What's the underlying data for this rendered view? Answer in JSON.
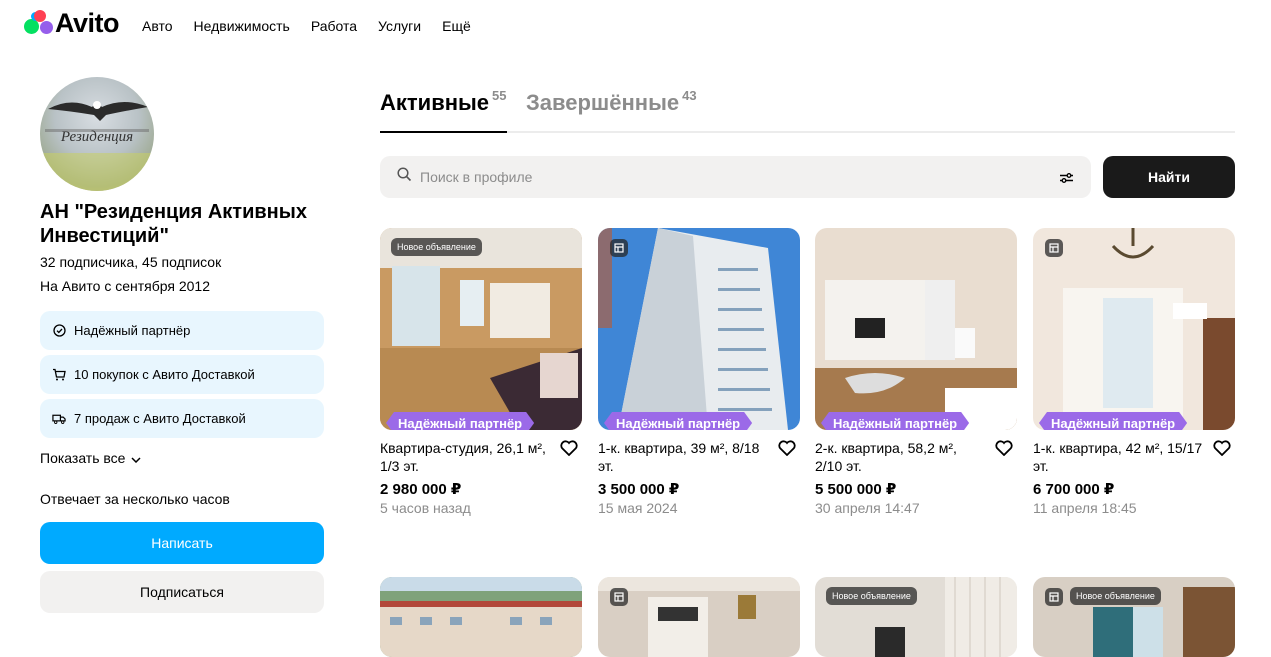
{
  "header": {
    "logo_text": "Avito",
    "nav": [
      "Авто",
      "Недвижимость",
      "Работа",
      "Услуги",
      "Ещё"
    ]
  },
  "profile": {
    "name": "АН \"Резиденция Активных Инвестиций\"",
    "subscribers": "32 подписчика, 45 подписок",
    "since": "На Авито с сентября 2012",
    "avatar_text": "Резиденция",
    "badges": [
      {
        "icon": "check-circle-icon",
        "label": "Надёжный партнёр"
      },
      {
        "icon": "cart-icon",
        "label": "10 покупок с Авито Доставкой"
      },
      {
        "icon": "truck-icon",
        "label": "7 продаж с Авито Доставкой"
      }
    ],
    "show_all": "Показать все",
    "response_time": "Отвечает за несколько часов",
    "write_button": "Написать",
    "subscribe_button": "Подписаться"
  },
  "tabs": [
    {
      "label": "Активные",
      "count": "55",
      "active": true
    },
    {
      "label": "Завершённые",
      "count": "43",
      "active": false
    }
  ],
  "search": {
    "placeholder": "Поиск в профиле",
    "button": "Найти"
  },
  "listings": [
    {
      "badge": "Новое объявление",
      "partner": "Надёжный партнёр",
      "title": "Квартира-студия, 26,1 м², 1/3 эт.",
      "price": "2 980 000 ₽",
      "date": "5 часов назад"
    },
    {
      "badge": "",
      "partner": "Надёжный партнёр",
      "title": "1-к. квартира, 39 м², 8/18 эт.",
      "price": "3 500 000 ₽",
      "date": "15 мая 2024"
    },
    {
      "badge": "",
      "partner": "Надёжный партнёр",
      "title": "2-к. квартира, 58,2 м², 2/10 эт.",
      "price": "5 500 000 ₽",
      "date": "30 апреля 14:47"
    },
    {
      "badge": "",
      "partner": "Надёжный партнёр",
      "title": "1-к. квартира, 42 м², 15/17 эт.",
      "price": "6 700 000 ₽",
      "date": "11 апреля 18:45"
    }
  ],
  "listings_row2": [
    {
      "badge": ""
    },
    {
      "badge": ""
    },
    {
      "badge": "Новое объявление"
    },
    {
      "badge": "Новое объявление"
    }
  ],
  "colors": {
    "accent_blue": "#00aaff",
    "partner_purple": "#9b6ae8",
    "badge_bg": "#e8f6fe"
  }
}
